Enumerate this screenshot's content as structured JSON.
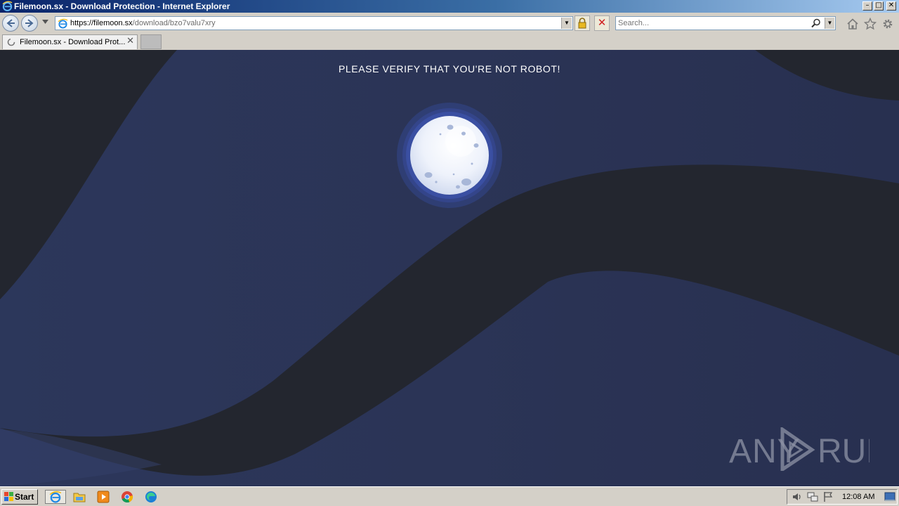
{
  "window": {
    "title": "Filemoon.sx - Download Protection - Internet Explorer",
    "min_glyph": "–",
    "max_glyph": "□",
    "close_glyph": "✕"
  },
  "address_bar": {
    "url_host": "https://filemoon.sx",
    "url_path": "/download/bzo7valu7xry",
    "dropdown_glyph": "▼"
  },
  "search": {
    "placeholder": "Search...",
    "dropdown_glyph": "▼"
  },
  "stop_glyph": "✕",
  "tabs": [
    {
      "label": "Filemoon.sx - Download Prot...",
      "close_glyph": "✕",
      "loading": true
    }
  ],
  "page": {
    "headline": "PLEASE VERIFY THAT YOU'RE NOT ROBOT!",
    "watermark": "ANY RUN"
  },
  "taskbar": {
    "start_label": "Start",
    "clock": "12:08 AM",
    "quick_launch": [
      "internet-explorer",
      "file-explorer",
      "media-player",
      "chrome",
      "edge"
    ]
  },
  "colors": {
    "page_bg": "#2a3353",
    "wave_dark": "#23262f",
    "headline": "#ffffff",
    "moon_glow": "#364a93"
  }
}
